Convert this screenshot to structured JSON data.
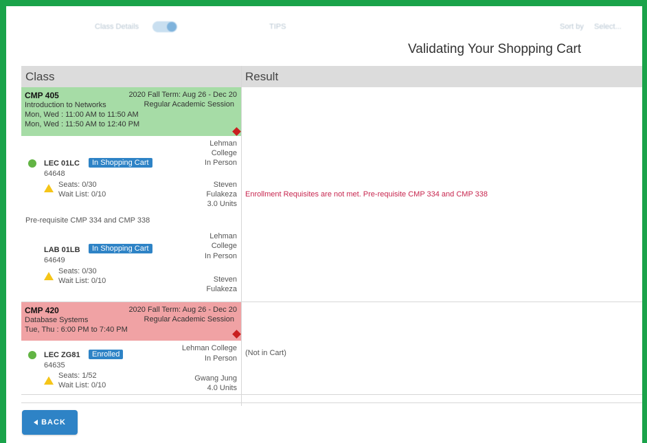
{
  "toolbar": {
    "left_label": "Class Details",
    "middle_label": "TIPS",
    "sort_label": "Sort by",
    "sort_value": "Select..."
  },
  "page": {
    "title": "Validating Your Shopping Cart"
  },
  "table": {
    "headers": {
      "class": "Class",
      "result": "Result"
    }
  },
  "courses": [
    {
      "code": "CMP 405",
      "term": "2020 Fall Term: Aug 26 - Dec 20",
      "name": "Introduction to Networks",
      "session": "Regular Academic Session",
      "meetings": [
        "Mon, Wed : 11:00 AM to 11:50 AM",
        "Mon, Wed : 11:50 AM to 12:40 PM"
      ],
      "header_color": "#a6dca6",
      "sections": [
        {
          "title": "LEC 01LC",
          "badge": "In Shopping Cart",
          "number": "64648",
          "seats": "Seats: 0/30",
          "waitlist": "Wait List: 0/10",
          "campus": "Lehman College",
          "mode": "In Person",
          "instructor": "Steven Fulakeza",
          "units": "3.0 Units",
          "status": "open"
        },
        {
          "title": "LAB 01LB",
          "badge": "In Shopping Cart",
          "number": "64649",
          "seats": "Seats: 0/30",
          "waitlist": "Wait List: 0/10",
          "campus": "Lehman College",
          "mode": "In Person",
          "instructor": "Steven Fulakeza"
        }
      ],
      "note": "Pre-requisite CMP 334 and CMP 338",
      "result": "Enrollment Requisites are not met. Pre-requisite CMP 334 and CMP 338"
    },
    {
      "code": "CMP 420",
      "term": "2020 Fall Term: Aug 26 - Dec 20",
      "name": "Database Systems",
      "session": "Regular Academic Session",
      "meetings": [
        "Tue, Thu : 6:00 PM to 7:40 PM"
      ],
      "header_color": "#f0a2a4",
      "sections": [
        {
          "title": "LEC ZG81",
          "badge": "Enrolled",
          "number": "64635",
          "seats": "Seats: 1/52",
          "waitlist": "Wait List: 0/10",
          "campus": "Lehman College",
          "mode": "In Person",
          "instructor": "Gwang Jung",
          "units": "4.0 Units",
          "status": "open"
        }
      ],
      "result": "(Not in Cart)"
    }
  ],
  "actions": {
    "back_label": "BACK"
  },
  "colors": {
    "frame": "#1aa34a",
    "badge": "#2e83c6",
    "error": "#c7254e",
    "open_dot": "#62b444",
    "warning": "#f5c518"
  }
}
